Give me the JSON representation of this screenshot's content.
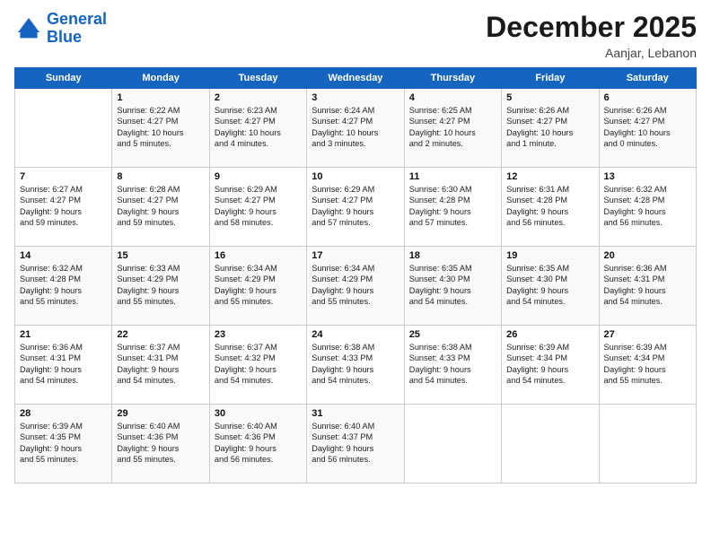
{
  "logo": {
    "line1": "General",
    "line2": "Blue"
  },
  "title": "December 2025",
  "location": "Aanjar, Lebanon",
  "weekdays": [
    "Sunday",
    "Monday",
    "Tuesday",
    "Wednesday",
    "Thursday",
    "Friday",
    "Saturday"
  ],
  "weeks": [
    [
      {
        "day": "",
        "info": ""
      },
      {
        "day": "1",
        "info": "Sunrise: 6:22 AM\nSunset: 4:27 PM\nDaylight: 10 hours\nand 5 minutes."
      },
      {
        "day": "2",
        "info": "Sunrise: 6:23 AM\nSunset: 4:27 PM\nDaylight: 10 hours\nand 4 minutes."
      },
      {
        "day": "3",
        "info": "Sunrise: 6:24 AM\nSunset: 4:27 PM\nDaylight: 10 hours\nand 3 minutes."
      },
      {
        "day": "4",
        "info": "Sunrise: 6:25 AM\nSunset: 4:27 PM\nDaylight: 10 hours\nand 2 minutes."
      },
      {
        "day": "5",
        "info": "Sunrise: 6:26 AM\nSunset: 4:27 PM\nDaylight: 10 hours\nand 1 minute."
      },
      {
        "day": "6",
        "info": "Sunrise: 6:26 AM\nSunset: 4:27 PM\nDaylight: 10 hours\nand 0 minutes."
      }
    ],
    [
      {
        "day": "7",
        "info": "Sunrise: 6:27 AM\nSunset: 4:27 PM\nDaylight: 9 hours\nand 59 minutes."
      },
      {
        "day": "8",
        "info": "Sunrise: 6:28 AM\nSunset: 4:27 PM\nDaylight: 9 hours\nand 59 minutes."
      },
      {
        "day": "9",
        "info": "Sunrise: 6:29 AM\nSunset: 4:27 PM\nDaylight: 9 hours\nand 58 minutes."
      },
      {
        "day": "10",
        "info": "Sunrise: 6:29 AM\nSunset: 4:27 PM\nDaylight: 9 hours\nand 57 minutes."
      },
      {
        "day": "11",
        "info": "Sunrise: 6:30 AM\nSunset: 4:28 PM\nDaylight: 9 hours\nand 57 minutes."
      },
      {
        "day": "12",
        "info": "Sunrise: 6:31 AM\nSunset: 4:28 PM\nDaylight: 9 hours\nand 56 minutes."
      },
      {
        "day": "13",
        "info": "Sunrise: 6:32 AM\nSunset: 4:28 PM\nDaylight: 9 hours\nand 56 minutes."
      }
    ],
    [
      {
        "day": "14",
        "info": "Sunrise: 6:32 AM\nSunset: 4:28 PM\nDaylight: 9 hours\nand 55 minutes."
      },
      {
        "day": "15",
        "info": "Sunrise: 6:33 AM\nSunset: 4:29 PM\nDaylight: 9 hours\nand 55 minutes."
      },
      {
        "day": "16",
        "info": "Sunrise: 6:34 AM\nSunset: 4:29 PM\nDaylight: 9 hours\nand 55 minutes."
      },
      {
        "day": "17",
        "info": "Sunrise: 6:34 AM\nSunset: 4:29 PM\nDaylight: 9 hours\nand 55 minutes."
      },
      {
        "day": "18",
        "info": "Sunrise: 6:35 AM\nSunset: 4:30 PM\nDaylight: 9 hours\nand 54 minutes."
      },
      {
        "day": "19",
        "info": "Sunrise: 6:35 AM\nSunset: 4:30 PM\nDaylight: 9 hours\nand 54 minutes."
      },
      {
        "day": "20",
        "info": "Sunrise: 6:36 AM\nSunset: 4:31 PM\nDaylight: 9 hours\nand 54 minutes."
      }
    ],
    [
      {
        "day": "21",
        "info": "Sunrise: 6:36 AM\nSunset: 4:31 PM\nDaylight: 9 hours\nand 54 minutes."
      },
      {
        "day": "22",
        "info": "Sunrise: 6:37 AM\nSunset: 4:31 PM\nDaylight: 9 hours\nand 54 minutes."
      },
      {
        "day": "23",
        "info": "Sunrise: 6:37 AM\nSunset: 4:32 PM\nDaylight: 9 hours\nand 54 minutes."
      },
      {
        "day": "24",
        "info": "Sunrise: 6:38 AM\nSunset: 4:33 PM\nDaylight: 9 hours\nand 54 minutes."
      },
      {
        "day": "25",
        "info": "Sunrise: 6:38 AM\nSunset: 4:33 PM\nDaylight: 9 hours\nand 54 minutes."
      },
      {
        "day": "26",
        "info": "Sunrise: 6:39 AM\nSunset: 4:34 PM\nDaylight: 9 hours\nand 54 minutes."
      },
      {
        "day": "27",
        "info": "Sunrise: 6:39 AM\nSunset: 4:34 PM\nDaylight: 9 hours\nand 55 minutes."
      }
    ],
    [
      {
        "day": "28",
        "info": "Sunrise: 6:39 AM\nSunset: 4:35 PM\nDaylight: 9 hours\nand 55 minutes."
      },
      {
        "day": "29",
        "info": "Sunrise: 6:40 AM\nSunset: 4:36 PM\nDaylight: 9 hours\nand 55 minutes."
      },
      {
        "day": "30",
        "info": "Sunrise: 6:40 AM\nSunset: 4:36 PM\nDaylight: 9 hours\nand 56 minutes."
      },
      {
        "day": "31",
        "info": "Sunrise: 6:40 AM\nSunset: 4:37 PM\nDaylight: 9 hours\nand 56 minutes."
      },
      {
        "day": "",
        "info": ""
      },
      {
        "day": "",
        "info": ""
      },
      {
        "day": "",
        "info": ""
      }
    ]
  ]
}
